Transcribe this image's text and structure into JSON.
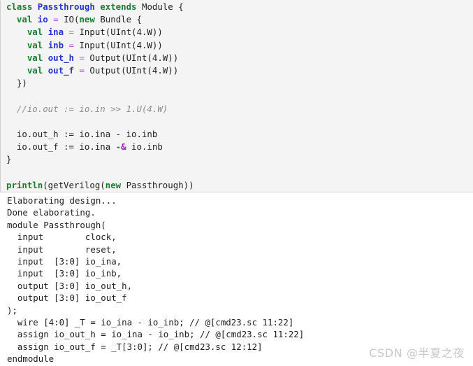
{
  "cell": {
    "kind": "scala-code-cell",
    "background": "#f4f4f4",
    "code_lines": [
      [
        {
          "t": "class ",
          "c": "kw"
        },
        {
          "t": "Passthrough ",
          "c": "id"
        },
        {
          "t": "extends ",
          "c": "kw"
        },
        {
          "t": "Module {",
          "c": "plain"
        }
      ],
      [
        {
          "t": "  val ",
          "c": "kw"
        },
        {
          "t": "io ",
          "c": "id"
        },
        {
          "t": "= ",
          "c": "eq"
        },
        {
          "t": "IO(",
          "c": "plain"
        },
        {
          "t": "new ",
          "c": "kw"
        },
        {
          "t": "Bundle {",
          "c": "plain"
        }
      ],
      [
        {
          "t": "    val ",
          "c": "kw"
        },
        {
          "t": "ina ",
          "c": "id"
        },
        {
          "t": "= ",
          "c": "eq"
        },
        {
          "t": "Input(UInt(4.W))",
          "c": "plain"
        }
      ],
      [
        {
          "t": "    val ",
          "c": "kw"
        },
        {
          "t": "inb ",
          "c": "id"
        },
        {
          "t": "= ",
          "c": "eq"
        },
        {
          "t": "Input(UInt(4.W))",
          "c": "plain"
        }
      ],
      [
        {
          "t": "    val ",
          "c": "kw"
        },
        {
          "t": "out_h ",
          "c": "id"
        },
        {
          "t": "= ",
          "c": "eq"
        },
        {
          "t": "Output(UInt(4.W))",
          "c": "plain"
        }
      ],
      [
        {
          "t": "    val ",
          "c": "kw"
        },
        {
          "t": "out_f ",
          "c": "id"
        },
        {
          "t": "= ",
          "c": "eq"
        },
        {
          "t": "Output(UInt(4.W))",
          "c": "plain"
        }
      ],
      [
        {
          "t": "  })",
          "c": "plain"
        }
      ],
      [],
      [
        {
          "t": "  //io.out := io.in >> 1.U(4.W)",
          "c": "cmt"
        }
      ],
      [],
      [
        {
          "t": "  io.out_h := io.ina - io.inb",
          "c": "plain"
        }
      ],
      [
        {
          "t": "  io.out_f := io.ina ",
          "c": "plain"
        },
        {
          "t": "-&",
          "c": "op"
        },
        {
          "t": " io.inb",
          "c": "plain"
        }
      ],
      [
        {
          "t": "}",
          "c": "plain"
        }
      ],
      [],
      [
        {
          "t": "println",
          "c": "kw"
        },
        {
          "t": "(getVerilog(",
          "c": "plain"
        },
        {
          "t": "new ",
          "c": "kw"
        },
        {
          "t": "Passthrough))",
          "c": "plain"
        }
      ]
    ]
  },
  "output": {
    "kind": "console-output",
    "lines": [
      "Elaborating design...",
      "Done elaborating.",
      "module Passthrough(",
      "  input        clock,",
      "  input        reset,",
      "  input  [3:0] io_ina,",
      "  input  [3:0] io_inb,",
      "  output [3:0] io_out_h,",
      "  output [3:0] io_out_f",
      ");",
      "  wire [4:0] _T = io_ina - io_inb; // @[cmd23.sc 11:22]",
      "  assign io_out_h = io_ina - io_inb; // @[cmd23.sc 11:22]",
      "  assign io_out_f = _T[3:0]; // @[cmd23.sc 12:12]",
      "endmodule"
    ]
  },
  "watermark": {
    "text": "CSDN @半夏之夜",
    "color": "#c8c8c8"
  }
}
